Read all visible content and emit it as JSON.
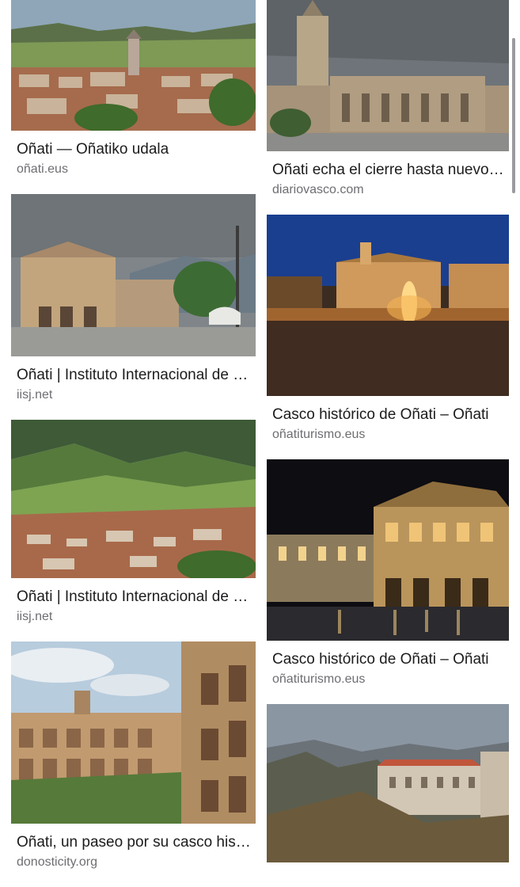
{
  "results_left": [
    {
      "title": "Oñati — Oñatiko udala",
      "source": "oñati.eus"
    },
    {
      "title": "Oñati | Instituto Internacional de Sociología Jurídica",
      "source": "iisj.net"
    },
    {
      "title": "Oñati | Instituto Internacional de Sociología Jurídica",
      "source": "iisj.net"
    },
    {
      "title": "Oñati, un paseo por su casco histórico",
      "source": "donosticity.org"
    }
  ],
  "results_right": [
    {
      "title": "Oñati echa el cierre hasta nuevo aviso",
      "source": "diariovasco.com"
    },
    {
      "title": "Casco histórico de Oñati – Oñati",
      "source": "oñatiturismo.eus"
    },
    {
      "title": "Casco histórico de Oñati – Oñati",
      "source": "oñatiturismo.eus"
    },
    {
      "title": "",
      "source": ""
    }
  ]
}
